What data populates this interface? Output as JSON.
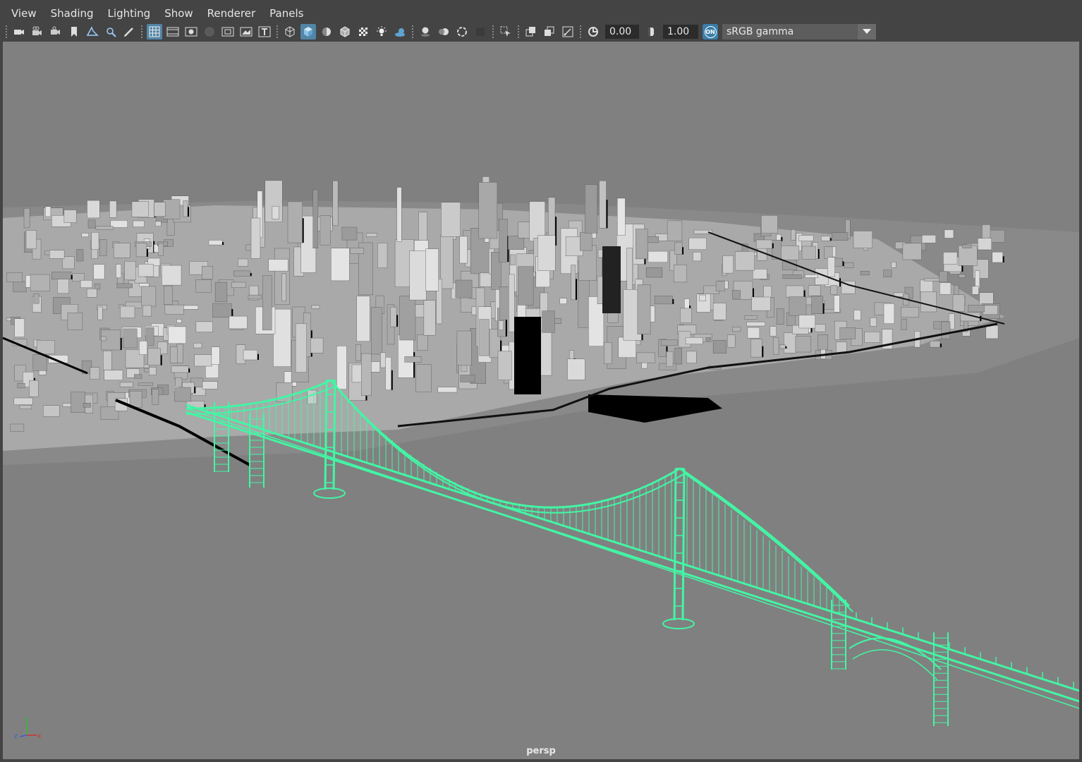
{
  "menubar": {
    "items": [
      "View",
      "Shading",
      "Lighting",
      "Show",
      "Renderer",
      "Panels"
    ]
  },
  "toolbar": {
    "groups": [
      [
        "camera-select-icon",
        "camera-attributes-icon",
        "camera-bookmark-icon",
        "bookmark-icon",
        "image-plane-icon",
        "2d-pan-zoom-icon",
        "grease-pencil-icon"
      ],
      [
        "grid-icon",
        "film-gate-icon",
        "resolution-gate-icon",
        "gate-mask-icon",
        "field-chart-icon",
        "safe-action-icon",
        "safe-title-icon"
      ],
      [
        "wireframe-icon",
        "smooth-shade-icon",
        "default-material-icon",
        "wireframe-on-shaded-icon",
        "textured-icon",
        "use-all-lights-icon",
        "shadows-icon"
      ],
      [
        "screen-space-ao-icon",
        "motion-blur-icon",
        "multisample-aa-icon",
        "depth-of-field-icon"
      ],
      [
        "isolate-select-icon"
      ],
      [
        "xray-icon",
        "xray-active-components-icon",
        "xray-joints-icon"
      ]
    ],
    "exposure_icon": "exposure-icon",
    "exposure_value": "0.00",
    "gamma_icon": "gamma-icon",
    "gamma_value": "1.00",
    "color_management_icon": "color-management-on-icon",
    "color_management_badge": "ON",
    "view_transform": "sRGB gamma"
  },
  "viewport": {
    "camera": "persp",
    "axis_labels": {
      "x": "x",
      "y": "y",
      "z": "z"
    },
    "background_color": "#808080",
    "selection_color": "#43f5a4",
    "axis_colors": {
      "x": "#d13030",
      "y": "#2ec02e",
      "z": "#3a5cd6"
    }
  }
}
